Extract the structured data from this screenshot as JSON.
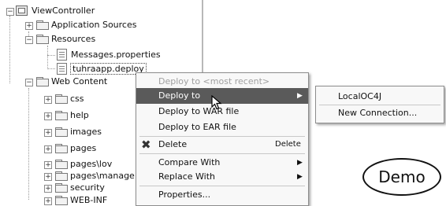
{
  "tree": {
    "nodes": [
      {
        "label": "ViewController",
        "icon": "view-controller-icon",
        "expander": "−"
      },
      {
        "label": "Application Sources",
        "icon": "folder-icon",
        "expander": "+"
      },
      {
        "label": "Resources",
        "icon": "folder-icon",
        "expander": "−"
      },
      {
        "label": "Messages.properties",
        "icon": "file-icon"
      },
      {
        "label": "tuhraapp.deploy",
        "icon": "deploy-file-icon"
      },
      {
        "label": "Web Content",
        "icon": "folder-icon",
        "expander": "−"
      },
      {
        "label": "css",
        "icon": "folder-icon",
        "expander": "+"
      },
      {
        "label": "help",
        "icon": "folder-icon",
        "expander": "+"
      },
      {
        "label": "images",
        "icon": "folder-icon",
        "expander": "+"
      },
      {
        "label": "pages",
        "icon": "folder-icon",
        "expander": "+"
      },
      {
        "label": "pages\\lov",
        "icon": "folder-icon",
        "expander": "+"
      },
      {
        "label": "pages\\manage",
        "icon": "folder-icon",
        "expander": "+"
      },
      {
        "label": "security",
        "icon": "folder-icon",
        "expander": "+"
      },
      {
        "label": "WEB-INF",
        "icon": "folder-icon",
        "expander": "+"
      }
    ]
  },
  "context_menu": {
    "items": [
      {
        "label": "Deploy to <most recent>",
        "disabled": true
      },
      {
        "label": "Deploy to",
        "highlighted": true,
        "submenu_arrow": "▶"
      },
      {
        "label": "Deploy to WAR file"
      },
      {
        "label": "Deploy to EAR file"
      },
      {
        "label": "Delete",
        "shortcut": "Delete",
        "icon": "delete-x-icon"
      },
      {
        "label": "Compare With",
        "submenu_arrow": "▶"
      },
      {
        "label": "Replace With",
        "submenu_arrow": "▶"
      },
      {
        "label": "Properties..."
      }
    ]
  },
  "submenu": {
    "items": [
      {
        "label": "LocalOC4J"
      },
      {
        "label": "New Connection..."
      }
    ]
  },
  "overlay": {
    "badge_text": "Demo"
  },
  "colors": {
    "highlight": "#5a5a5a",
    "menu_bg": "#f8f8f8",
    "disabled_text": "#a0a0a0",
    "delete_icon": "#333333"
  }
}
